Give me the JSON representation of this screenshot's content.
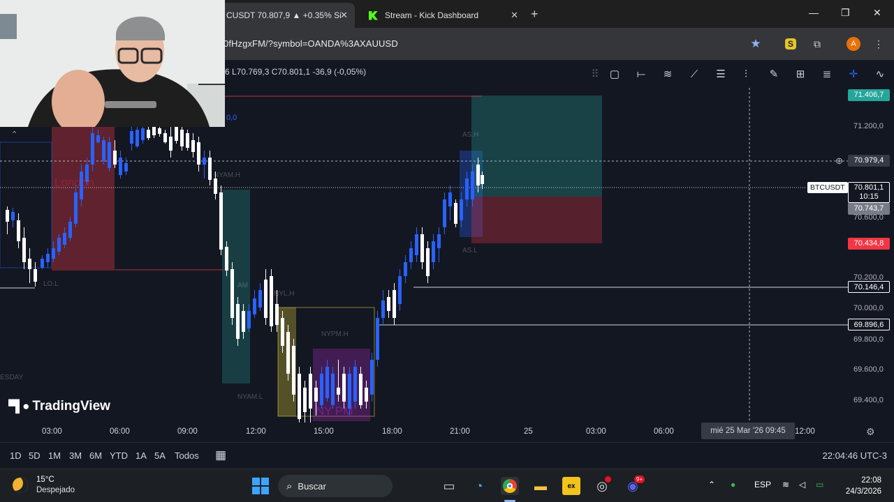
{
  "browser": {
    "tabs": [
      {
        "title": "CUSDT 70.807,9 ▲ +0.35% Si",
        "active": true
      },
      {
        "title": "Stream - Kick Dashboard",
        "active": false
      }
    ],
    "new_tab": "+",
    "close_glyph": "✕",
    "url": "0fHzgxFM/?symbol=OANDA%3AXAUUSD",
    "profile_initial": "A",
    "ext_letter": "S"
  },
  "tradingview": {
    "ohlc": "6 L70.769,3 C70.801,1 -36,9 (-0,05%)",
    "partial_value": "0,0",
    "symbol": "BTCUSDT",
    "countdown": "10:15",
    "price_labels": [
      {
        "text": "71.406,7",
        "color": "#26a69a"
      },
      {
        "text": "70.979,4",
        "color": "#363a45"
      },
      {
        "text": "70.801,1",
        "color": "#131722"
      },
      {
        "text": "70.743,7",
        "color": "#787b86"
      },
      {
        "text": "70.434,8",
        "color": "#f23645"
      },
      {
        "text": "70.146,4",
        "color": "#131722"
      },
      {
        "text": "69.896,6",
        "color": "#131722"
      }
    ],
    "axis_ticks": [
      "71.200,0",
      "70.600,0",
      "70.200,0",
      "70.000,0",
      "69.800,0",
      "69.600,0",
      "69.400,0"
    ],
    "time_ticks": [
      "03:00",
      "06:00",
      "09:00",
      "12:00",
      "15:00",
      "18:00",
      "21:00",
      "25",
      "03:00",
      "06:00",
      "12:00"
    ],
    "crosshair_date": "mié 25 Mar '26   09:45",
    "logo": "TradingView",
    "session_labels": [
      "London",
      "AS.H",
      "AS.L",
      "NYAM.H",
      "NYAM.L",
      "NYL.H",
      "NYPM.H",
      "NY PM",
      "LO.L",
      "AM",
      "ESDAY"
    ],
    "ranges": [
      "1D",
      "5D",
      "1M",
      "3M",
      "6M",
      "YTD",
      "1A",
      "5A",
      "Todos"
    ],
    "clock": "22:04:46 UTC-3"
  },
  "taskbar": {
    "temp": "15°C",
    "weather": "Despejado",
    "search": "Buscar",
    "discord_badge": "9+",
    "lang": "ESP",
    "time": "22:08",
    "date": "24/3/2026"
  }
}
